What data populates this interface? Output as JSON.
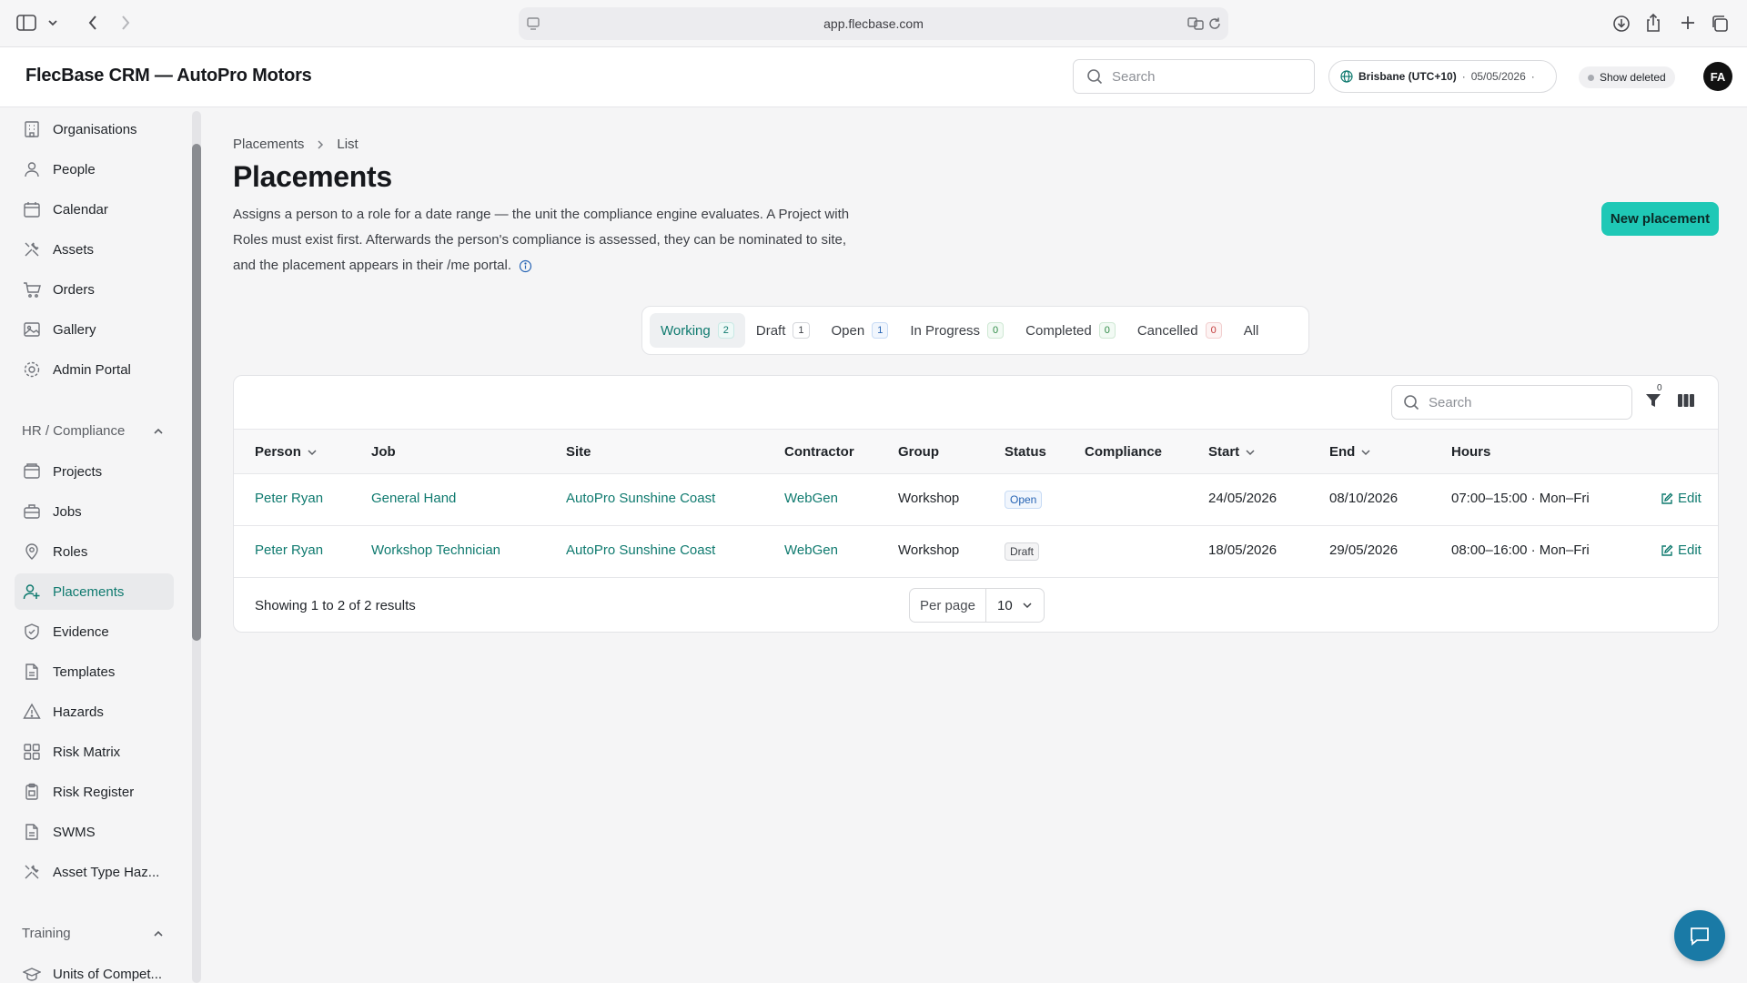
{
  "browser": {
    "url": "app.flecbase.com"
  },
  "header": {
    "brand": "FlecBase CRM — AutoPro Motors",
    "search_placeholder": "Search",
    "timezone": "Brisbane (UTC+10)",
    "date": "05/05/2026",
    "show_deleted": "Show deleted",
    "avatar_initials": "FA"
  },
  "sidebar": {
    "top_items": [
      {
        "label": "Organisations",
        "icon": "building-icon"
      },
      {
        "label": "People",
        "icon": "person-icon"
      },
      {
        "label": "Calendar",
        "icon": "calendar-icon"
      },
      {
        "label": "Assets",
        "icon": "tools-icon"
      },
      {
        "label": "Orders",
        "icon": "cart-icon"
      },
      {
        "label": "Gallery",
        "icon": "image-icon"
      },
      {
        "label": "Admin Portal",
        "icon": "gear-icon"
      }
    ],
    "section_hr": "HR / Compliance",
    "hr_items": [
      {
        "label": "Projects",
        "icon": "folder-icon"
      },
      {
        "label": "Jobs",
        "icon": "briefcase-icon"
      },
      {
        "label": "Roles",
        "icon": "location-icon"
      },
      {
        "label": "Placements",
        "icon": "user-plus-icon"
      },
      {
        "label": "Evidence",
        "icon": "shield-check-icon"
      },
      {
        "label": "Templates",
        "icon": "document-icon"
      },
      {
        "label": "Hazards",
        "icon": "warning-icon"
      },
      {
        "label": "Risk Matrix",
        "icon": "grid-icon"
      },
      {
        "label": "Risk Register",
        "icon": "clipboard-icon"
      },
      {
        "label": "SWMS",
        "icon": "document-icon"
      },
      {
        "label": "Asset Type Haz...",
        "icon": "tools-icon"
      }
    ],
    "section_training": "Training",
    "training_items": [
      {
        "label": "Units of Compet...",
        "icon": "graduation-cap-icon"
      }
    ]
  },
  "page": {
    "breadcrumb": [
      "Placements",
      "List"
    ],
    "title": "Placements",
    "description": "Assigns a person to a role for a date range — the unit the compliance engine evaluates. A Project with Roles must exist first. Afterwards the person's compliance is assessed, they can be nominated to site, and the placement appears in their /me portal.",
    "new_button": "New placement"
  },
  "tabs": [
    {
      "label": "Working",
      "count": "2",
      "style": "teal"
    },
    {
      "label": "Draft",
      "count": "1",
      "style": "grey"
    },
    {
      "label": "Open",
      "count": "1",
      "style": "blue"
    },
    {
      "label": "In Progress",
      "count": "0",
      "style": "green"
    },
    {
      "label": "Completed",
      "count": "0",
      "style": "green"
    },
    {
      "label": "Cancelled",
      "count": "0",
      "style": "red"
    },
    {
      "label": "All",
      "count": "",
      "style": ""
    }
  ],
  "table": {
    "search_placeholder": "Search",
    "filter_count": "0",
    "columns": [
      "Person",
      "Job",
      "Site",
      "Contractor",
      "Group",
      "Status",
      "Compliance",
      "Start",
      "End",
      "Hours"
    ],
    "rows": [
      {
        "person": "Peter Ryan",
        "job": "General Hand",
        "site": "AutoPro Sunshine Coast",
        "contractor": "WebGen",
        "group": "Workshop",
        "status": "Open",
        "compliance": "",
        "start": "24/05/2026",
        "end": "08/10/2026",
        "hours": "07:00–15:00 · Mon–Fri",
        "action": "Edit"
      },
      {
        "person": "Peter Ryan",
        "job": "Workshop Technician",
        "site": "AutoPro Sunshine Coast",
        "contractor": "WebGen",
        "group": "Workshop",
        "status": "Draft",
        "compliance": "",
        "start": "18/05/2026",
        "end": "29/05/2026",
        "hours": "08:00–16:00 · Mon–Fri",
        "action": "Edit"
      }
    ],
    "footer": "Showing 1 to 2 of 2 results",
    "per_page_label": "Per page",
    "per_page_value": "10"
  },
  "colors": {
    "accent": "#0f7a6f",
    "primary_button": "#1fc8b6",
    "chat": "#1a7aa6"
  }
}
